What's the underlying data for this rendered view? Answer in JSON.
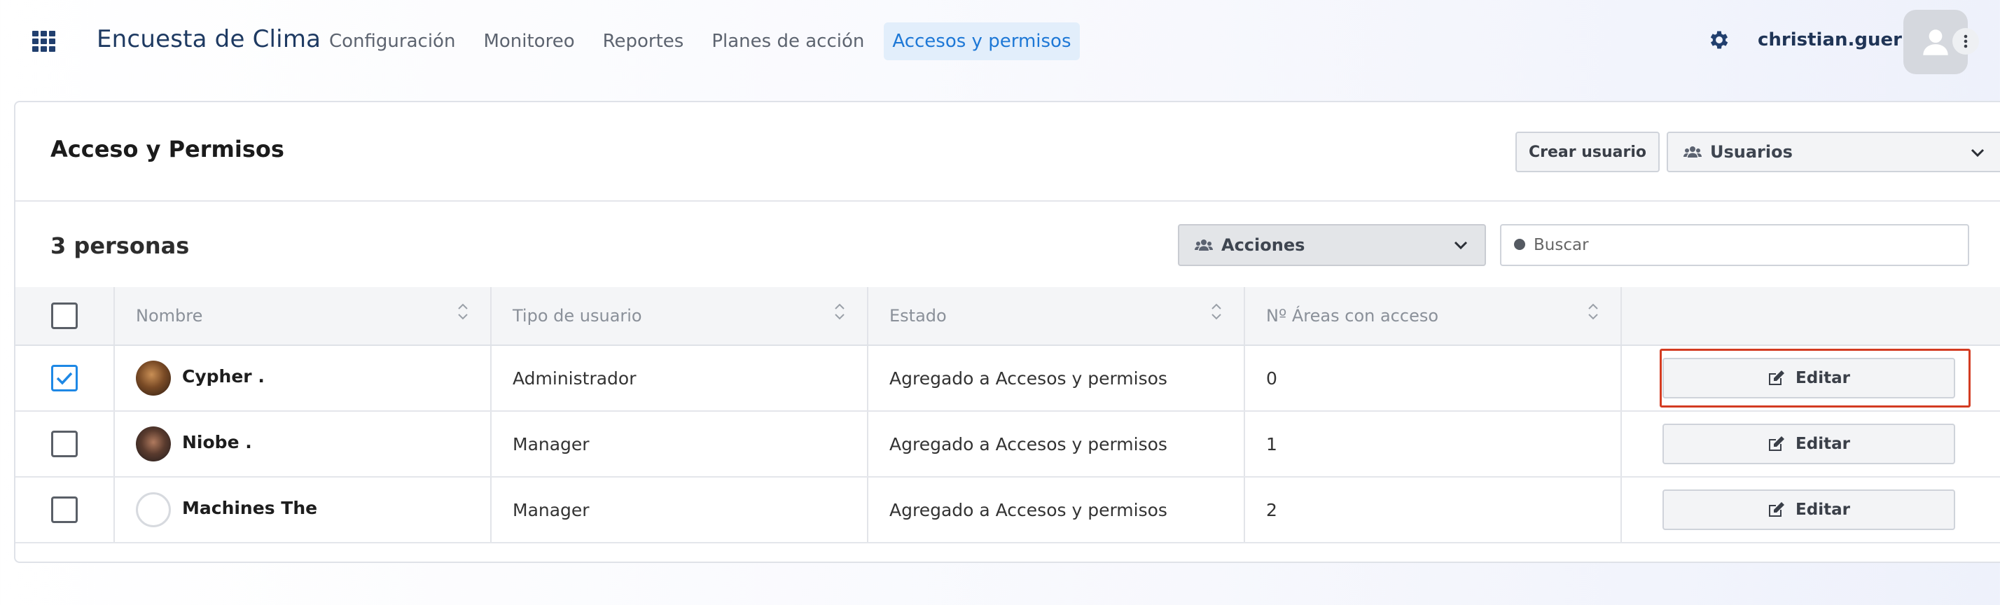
{
  "topbar": {
    "app_title": "Encuesta de Clima",
    "nav": [
      {
        "label": "Configuración",
        "active": false
      },
      {
        "label": "Monitoreo",
        "active": false
      },
      {
        "label": "Reportes",
        "active": false
      },
      {
        "label": "Planes de acción",
        "active": false
      },
      {
        "label": "Accesos y permisos",
        "active": true
      }
    ],
    "username": "christian.guerra",
    "icons": {
      "apps": "grid-apps-icon",
      "settings": "gear-icon",
      "avatar": "user-avatar-icon",
      "menu": "kebab-menu-icon"
    }
  },
  "header": {
    "title": "Acceso y Permisos",
    "create_button": "Crear usuario",
    "users_select": "Usuarios"
  },
  "toolbar": {
    "count_label": "3 personas",
    "actions_select": "Acciones",
    "search_placeholder": "Buscar"
  },
  "table": {
    "columns": [
      "Nombre",
      "Tipo de usuario",
      "Estado",
      "Nº Áreas con acceso"
    ],
    "rows": [
      {
        "checked": true,
        "name": "Cypher .",
        "type": "Administrador",
        "status": "Agregado a Accesos y permisos",
        "areas": "0",
        "action": "Editar"
      },
      {
        "checked": false,
        "name": "Niobe .",
        "type": "Manager",
        "status": "Agregado a Accesos y permisos",
        "areas": "1",
        "action": "Editar"
      },
      {
        "checked": false,
        "name": "Machines The",
        "type": "Manager",
        "status": "Agregado a Accesos y permisos",
        "areas": "2",
        "action": "Editar"
      }
    ]
  },
  "colors": {
    "accent": "#1e78d6",
    "highlight": "#d33c22",
    "brand_dark": "#1e3a62"
  }
}
